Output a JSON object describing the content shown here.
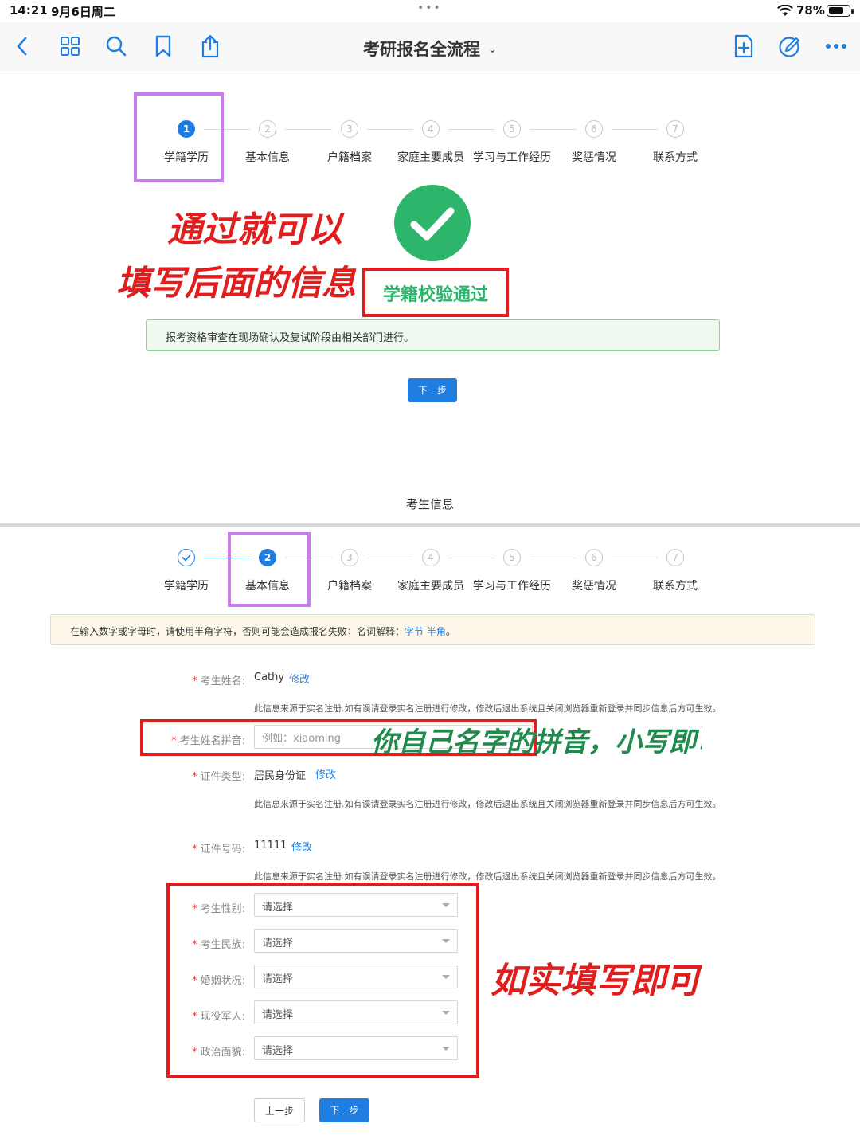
{
  "status_bar": {
    "time": "14:21",
    "date": "9月6日周二",
    "multitask_dots": "•••",
    "battery_percent": "78%",
    "battery_level": 0.78,
    "wifi_icon": "wifi-icon",
    "battery_icon": "battery-icon"
  },
  "toolbar": {
    "title": "考研报名全流程",
    "title_chevron": "⌄",
    "left_icons": [
      "back-chevron-icon",
      "grid-icon",
      "search-icon",
      "bookmark-icon",
      "share-icon"
    ],
    "right_icons": [
      "add-page-icon",
      "markup-icon",
      "more-icon"
    ],
    "accent_color": "#1f7ee0"
  },
  "steps": [
    {
      "number": "1",
      "label": "学籍学历"
    },
    {
      "number": "2",
      "label": "基本信息"
    },
    {
      "number": "3",
      "label": "户籍档案"
    },
    {
      "number": "4",
      "label": "家庭主要成员"
    },
    {
      "number": "5",
      "label": "学习与工作经历"
    },
    {
      "number": "6",
      "label": "奖惩情况"
    },
    {
      "number": "7",
      "label": "联系方式"
    }
  ],
  "section1": {
    "active_step": "1",
    "success_icon": "check-circle-icon",
    "success_text": "学籍校验通过",
    "notice": "报考资格审查在现场确认及复试阶段由相关部门进行。",
    "next_button": "下一步",
    "annotation_line1": "通过就可以",
    "annotation_line2": "填写后面的信息了"
  },
  "section_title": "考生信息",
  "section2": {
    "active_step": "2",
    "completed_step_icon": "check-icon",
    "notice_text": "在输入数字或字母时，请使用半角字符，否则可能会造成报名失败；名词解释：",
    "notice_link1": "字节",
    "notice_link2": "半角",
    "notice_end": "。",
    "required_mark": "*",
    "fields": {
      "name": {
        "label": "考生姓名:",
        "value": "Cathy",
        "edit": "修改"
      },
      "pinyin": {
        "label": "考生姓名拼音:",
        "placeholder": "例如：xiaoming"
      },
      "id_type": {
        "label": "证件类型:",
        "value": "居民身份证",
        "edit": "修改"
      },
      "id_number": {
        "label": "证件号码:",
        "value": "11111",
        "edit": "修改"
      },
      "hint": "此信息来源于实名注册.如有误请登录实名注册进行修改，修改后退出系统且关闭浏览器重新登录并同步信息后方可生效。"
    },
    "selects": [
      {
        "label": "考生性别:",
        "value": "请选择"
      },
      {
        "label": "考生民族:",
        "value": "请选择"
      },
      {
        "label": "婚姻状况:",
        "value": "请选择"
      },
      {
        "label": "现役军人:",
        "value": "请选择"
      },
      {
        "label": "政治面貌:",
        "value": "请选择"
      }
    ],
    "prev_button": "上一步",
    "next_button": "下一步",
    "annotation_pinyin": "你自己名字的拼音，小写即可",
    "annotation_fill": "如实填写即可"
  }
}
